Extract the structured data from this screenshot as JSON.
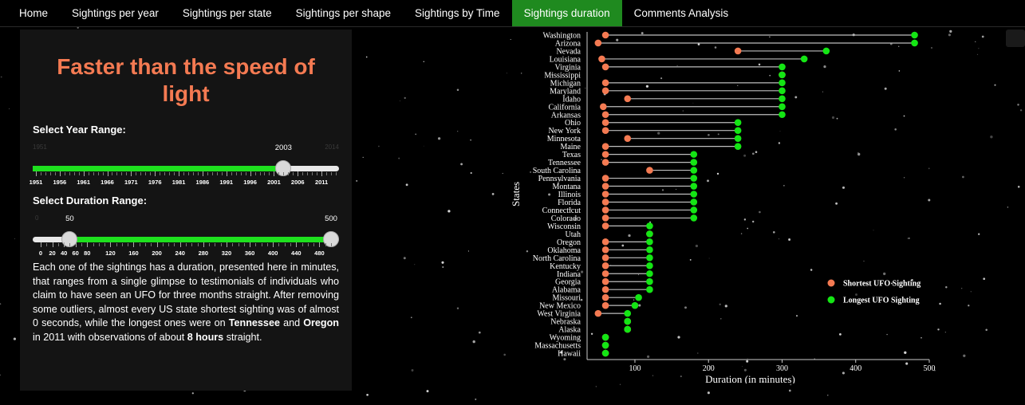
{
  "nav": {
    "items": [
      {
        "label": "Home"
      },
      {
        "label": "Sightings per year"
      },
      {
        "label": "Sightings per state"
      },
      {
        "label": "Sightings per shape"
      },
      {
        "label": "Sightings by Time"
      },
      {
        "label": "Sightings duration"
      },
      {
        "label": "Comments Analysis"
      }
    ],
    "active_index": 5
  },
  "panel": {
    "title": "Faster than the speed of light",
    "year_slider": {
      "label": "Select Year Range:",
      "min": 1951,
      "max": 2014,
      "min_label": "1951",
      "max_label": "2014",
      "selected": 2003,
      "selected_label": "2003",
      "tick_labels": [
        "1951",
        "1956",
        "1961",
        "1966",
        "1971",
        "1976",
        "1981",
        "1986",
        "1991",
        "1996",
        "2001",
        "2006",
        "2011"
      ]
    },
    "duration_slider": {
      "label": "Select Duration Range:",
      "min": 0,
      "max": 500,
      "min_label": "0",
      "low": 50,
      "high": 500,
      "low_label": "50",
      "high_label": "500",
      "tick_labels": [
        "0",
        "20",
        "40",
        "60",
        "80",
        "120",
        "160",
        "200",
        "240",
        "280",
        "320",
        "360",
        "400",
        "440",
        "480"
      ]
    },
    "description": {
      "p1": "Each one of the sightings has a duration, presented here in minutes, that ranges from a single glimpse to testimonials of individuals who claim to have seen an UFO for three months straight. After removing some outliers, almost every US state shortest sighting was of almost 0 seconds, while the longest ones were on ",
      "b1": "Tennessee",
      "p2": " and ",
      "b2": "Oregon",
      "p3": " in 2011 with observations of about ",
      "b3": "8 hours",
      "p4": " straight."
    }
  },
  "colors": {
    "accent_orange": "#f47a52",
    "active_tab": "#1f8a1f",
    "slider_fill": "#1ee01e",
    "shortest": "#f47a52",
    "longest": "#14e614",
    "segment": "#bdbdbd"
  },
  "chart_data": {
    "type": "dumbbell",
    "xlabel": "Duration (in minutes)",
    "ylabel": "States",
    "xlim": [
      35,
      500
    ],
    "xticks": [
      100,
      200,
      300,
      400,
      500
    ],
    "legend_position": "right",
    "series": [
      {
        "name": "Shortest UFO Sighting",
        "key": "short"
      },
      {
        "name": "Longest UFO Sighting",
        "key": "long"
      }
    ],
    "rows": [
      {
        "state": "Washington",
        "short": 60,
        "long": 480
      },
      {
        "state": "Arizona",
        "short": 50,
        "long": 480
      },
      {
        "state": "Nevada",
        "short": 240,
        "long": 360
      },
      {
        "state": "Louisiana",
        "short": 55,
        "long": 330
      },
      {
        "state": "Virginia",
        "short": 60,
        "long": 300
      },
      {
        "state": "Mississippi",
        "short": 300,
        "long": 300
      },
      {
        "state": "Michigan",
        "short": 60,
        "long": 300
      },
      {
        "state": "Maryland",
        "short": 60,
        "long": 300
      },
      {
        "state": "Idaho",
        "short": 90,
        "long": 300
      },
      {
        "state": "California",
        "short": 57,
        "long": 300
      },
      {
        "state": "Arkansas",
        "short": 60,
        "long": 300
      },
      {
        "state": "Ohio",
        "short": 60,
        "long": 240
      },
      {
        "state": "New York",
        "short": 60,
        "long": 240
      },
      {
        "state": "Minnesota",
        "short": 90,
        "long": 240
      },
      {
        "state": "Maine",
        "short": 60,
        "long": 240
      },
      {
        "state": "Texas",
        "short": 60,
        "long": 180
      },
      {
        "state": "Tennessee",
        "short": 60,
        "long": 180
      },
      {
        "state": "South Carolina",
        "short": 120,
        "long": 180
      },
      {
        "state": "Pennsylvania",
        "short": 60,
        "long": 180
      },
      {
        "state": "Montana",
        "short": 60,
        "long": 180
      },
      {
        "state": "Illinois",
        "short": 60,
        "long": 180
      },
      {
        "state": "Florida",
        "short": 60,
        "long": 180
      },
      {
        "state": "Connecticut",
        "short": 60,
        "long": 180
      },
      {
        "state": "Colorado",
        "short": 60,
        "long": 180
      },
      {
        "state": "Wisconsin",
        "short": 60,
        "long": 120
      },
      {
        "state": "Utah",
        "short": 120,
        "long": 120
      },
      {
        "state": "Oregon",
        "short": 60,
        "long": 120
      },
      {
        "state": "Oklahoma",
        "short": 60,
        "long": 120
      },
      {
        "state": "North Carolina",
        "short": 60,
        "long": 120
      },
      {
        "state": "Kentucky",
        "short": 60,
        "long": 120
      },
      {
        "state": "Indiana",
        "short": 60,
        "long": 120
      },
      {
        "state": "Georgia",
        "short": 60,
        "long": 120
      },
      {
        "state": "Alabama",
        "short": 60,
        "long": 120
      },
      {
        "state": "Missouri",
        "short": 60,
        "long": 105
      },
      {
        "state": "New Mexico",
        "short": 60,
        "long": 100
      },
      {
        "state": "West Virginia",
        "short": 50,
        "long": 90
      },
      {
        "state": "Nebraska",
        "short": 90,
        "long": 90
      },
      {
        "state": "Alaska",
        "short": 90,
        "long": 90
      },
      {
        "state": "Wyoming",
        "short": 60,
        "long": 60
      },
      {
        "state": "Massachusetts",
        "short": 60,
        "long": 60
      },
      {
        "state": "Hawaii",
        "short": 60,
        "long": 60
      }
    ]
  }
}
